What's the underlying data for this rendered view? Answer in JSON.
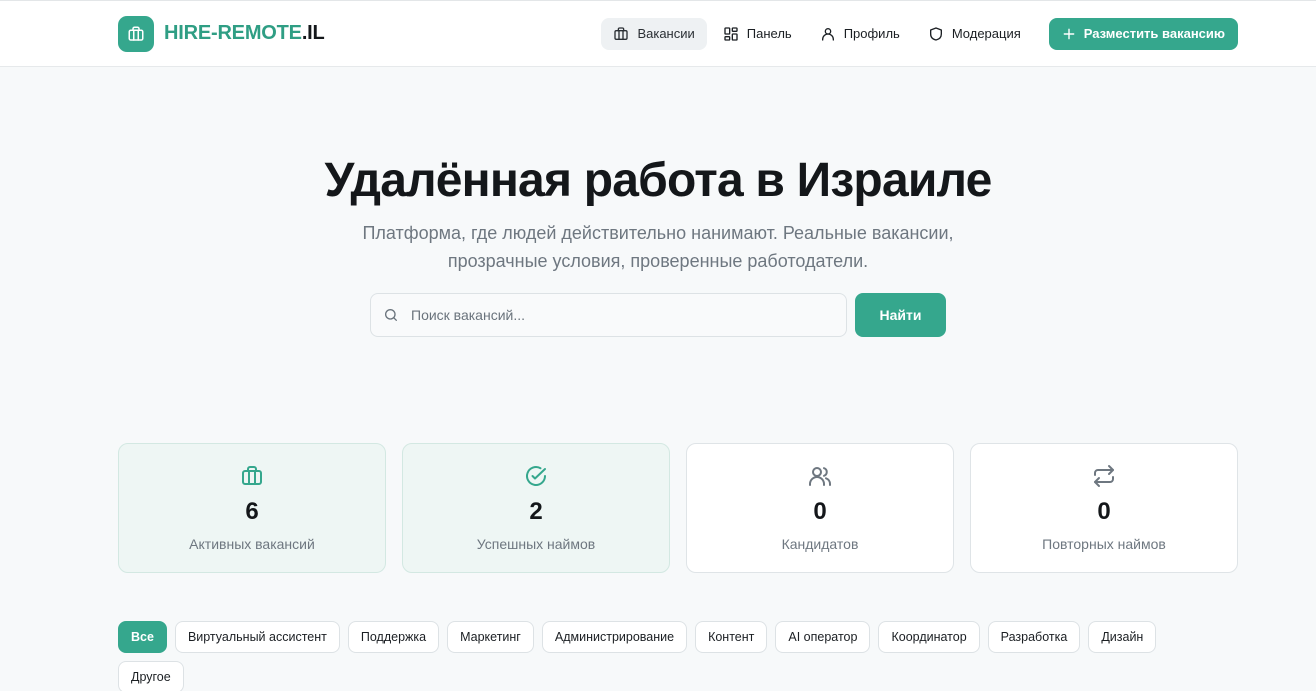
{
  "header": {
    "logo_accent": "HIRE-REMOTE",
    "logo_rest": ".IL",
    "nav": [
      {
        "label": "Вакансии",
        "icon": "briefcase-icon",
        "active": true
      },
      {
        "label": "Панель",
        "icon": "grid-icon",
        "active": false
      },
      {
        "label": "Профиль",
        "icon": "user-icon",
        "active": false
      },
      {
        "label": "Модерация",
        "icon": "shield-icon",
        "active": false
      }
    ],
    "post_label": "Разместить вакансию"
  },
  "hero": {
    "title": "Удалённая работа в Израиле",
    "subtitle": "Платформа, где людей действительно нанимают. Реальные вакансии, прозрачные условия, проверенные работодатели."
  },
  "search": {
    "placeholder": "Поиск вакансий...",
    "value": "",
    "button_label": "Найти"
  },
  "stats": [
    {
      "value": "6",
      "label": "Активных вакансий",
      "icon": "briefcase-icon"
    },
    {
      "value": "2",
      "label": "Успешных наймов",
      "icon": "check-circle-icon"
    },
    {
      "value": "0",
      "label": "Кандидатов",
      "icon": "users-icon"
    },
    {
      "value": "0",
      "label": "Повторных наймов",
      "icon": "repeat-icon"
    }
  ],
  "categories": [
    "Все",
    "Виртуальный ассистент",
    "Поддержка",
    "Маркетинг",
    "Администрирование",
    "Контент",
    "AI оператор",
    "Координатор",
    "Разработка",
    "Дизайн",
    "Другое"
  ],
  "colors": {
    "accent": "#35a78d",
    "background": "#f7f9fa",
    "muted_text": "#6e7780"
  }
}
